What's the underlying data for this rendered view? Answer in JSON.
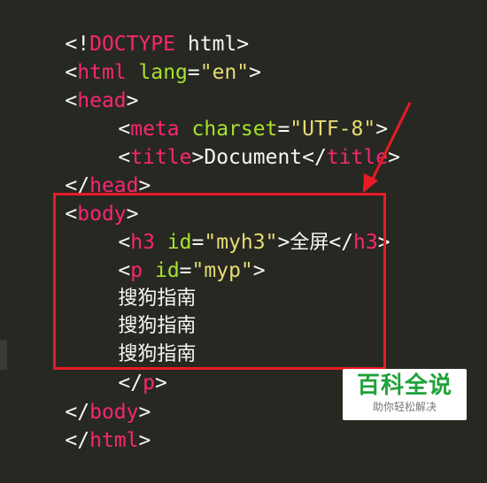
{
  "editor": {
    "theme_colors": {
      "background": "#272822",
      "tag": "#f92672",
      "attribute": "#a6e22e",
      "string": "#e6db74",
      "text": "#f8f8f2"
    },
    "lines": [
      {
        "doctype_open": "<!",
        "doctype_keyword": "DOCTYPE",
        "doctype_rest": " html>"
      },
      {
        "open": "<",
        "tag": "html",
        "space": " ",
        "attr": "lang",
        "eq": "=",
        "value": "\"en\"",
        "close": ">"
      },
      {
        "open": "<",
        "tag": "head",
        "close": ">"
      },
      {
        "open": "<",
        "tag": "meta",
        "space": " ",
        "attr": "charset",
        "eq": "=",
        "value": "\"UTF-8\"",
        "close": ">"
      },
      {
        "open": "<",
        "tag": "title",
        "close": ">",
        "text": "Document",
        "end_open": "</",
        "end_tag": "title",
        "end_close": ">"
      },
      {
        "open": "</",
        "tag": "head",
        "close": ">"
      },
      {
        "open": "<",
        "tag": "body",
        "close": ">"
      },
      {
        "open": "<",
        "tag": "h3",
        "space": " ",
        "attr": "id",
        "eq": "=",
        "value": "\"myh3\"",
        "close": ">",
        "text": "全屏",
        "end_open": "</",
        "end_tag": "h3",
        "end_close": ">"
      },
      {
        "open": "<",
        "tag": "p",
        "space": " ",
        "attr": "id",
        "eq": "=",
        "value": "\"myp\"",
        "close": ">"
      },
      {
        "text": "搜狗指南"
      },
      {
        "text": "搜狗指南"
      },
      {
        "text": "搜狗指南"
      },
      {
        "open": "</",
        "tag": "p",
        "close": ">"
      },
      {
        "open": "</",
        "tag": "body",
        "close": ">"
      },
      {
        "open": "</",
        "tag": "html",
        "close": ">"
      }
    ]
  },
  "annotation": {
    "box_color": "#e81b25"
  },
  "watermark": {
    "title": "百科全说",
    "subtitle": "助你轻松解决",
    "title_color": "#1fa23a"
  }
}
